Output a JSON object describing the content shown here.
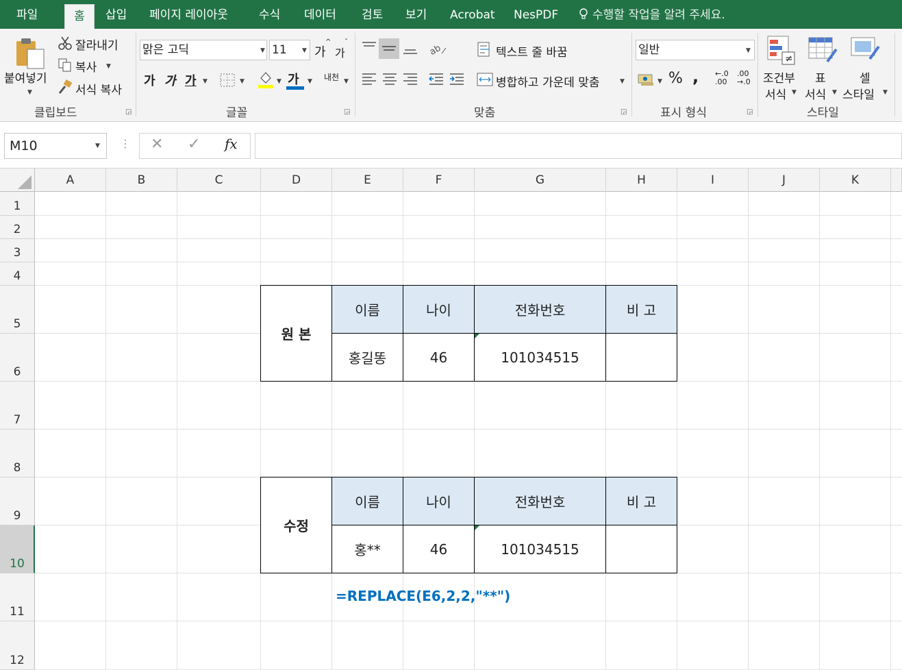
{
  "menu": {
    "file": "파일",
    "home": "홈",
    "insert": "삽입",
    "page_layout": "페이지 레이아웃",
    "formulas": "수식",
    "data": "데이터",
    "review": "검토",
    "view": "보기",
    "acrobat": "Acrobat",
    "nespdf": "NesPDF",
    "tell_me": "수행할 작업을 알려 주세요."
  },
  "clipboard": {
    "paste": "붙여넣기",
    "cut": "잘라내기",
    "copy": "복사",
    "format_painter": "서식 복사",
    "label": "클립보드"
  },
  "font": {
    "name": "맑은 고딕",
    "size": "11",
    "grow": "가",
    "shrink": "가",
    "bold": "가",
    "italic": "가",
    "underline": "가",
    "font_color_glyph": "가",
    "phonetic": "내천",
    "label": "글꼴"
  },
  "alignment": {
    "wrap_text": "텍스트 줄 바꿈",
    "merge_center": "병합하고 가운데 맞춤",
    "label": "맞춤"
  },
  "number": {
    "format": "일반",
    "percent": "%",
    "comma": ",",
    "inc_decimal": "←.0 .00",
    "dec_decimal": ".00 →.0",
    "label": "표시 형식"
  },
  "styles": {
    "conditional_line1": "조건부",
    "conditional_line2": "서식",
    "table_line1": "표",
    "table_line2": "서식",
    "cell_line1": "셀",
    "cell_line2": "스타일",
    "label": "스타일"
  },
  "formula_bar": {
    "name_box": "M10",
    "cancel": "✕",
    "enter": "✓",
    "fx": "fx",
    "content": ""
  },
  "columns": [
    "A",
    "B",
    "C",
    "D",
    "E",
    "F",
    "G",
    "H",
    "I",
    "J",
    "K"
  ],
  "rows": [
    "1",
    "2",
    "3",
    "4",
    "5",
    "6",
    "7",
    "8",
    "9",
    "10",
    "11",
    "12"
  ],
  "active_row": "10",
  "table_original": {
    "title": "원 본",
    "headers": [
      "이름",
      "나이",
      "전화번호",
      "비 고"
    ],
    "values": [
      "홍길똥",
      "46",
      "101034515",
      ""
    ]
  },
  "table_modified": {
    "title": "수정",
    "headers": [
      "이름",
      "나이",
      "전화번호",
      "비 고"
    ],
    "values": [
      "홍**",
      "46",
      "101034515",
      ""
    ]
  },
  "formula_note": "=REPLACE(E6,2,2,\"**\")",
  "colors": {
    "excel_green": "#217346",
    "header_fill": "#dce9f5",
    "formula_blue": "#0070c0"
  }
}
